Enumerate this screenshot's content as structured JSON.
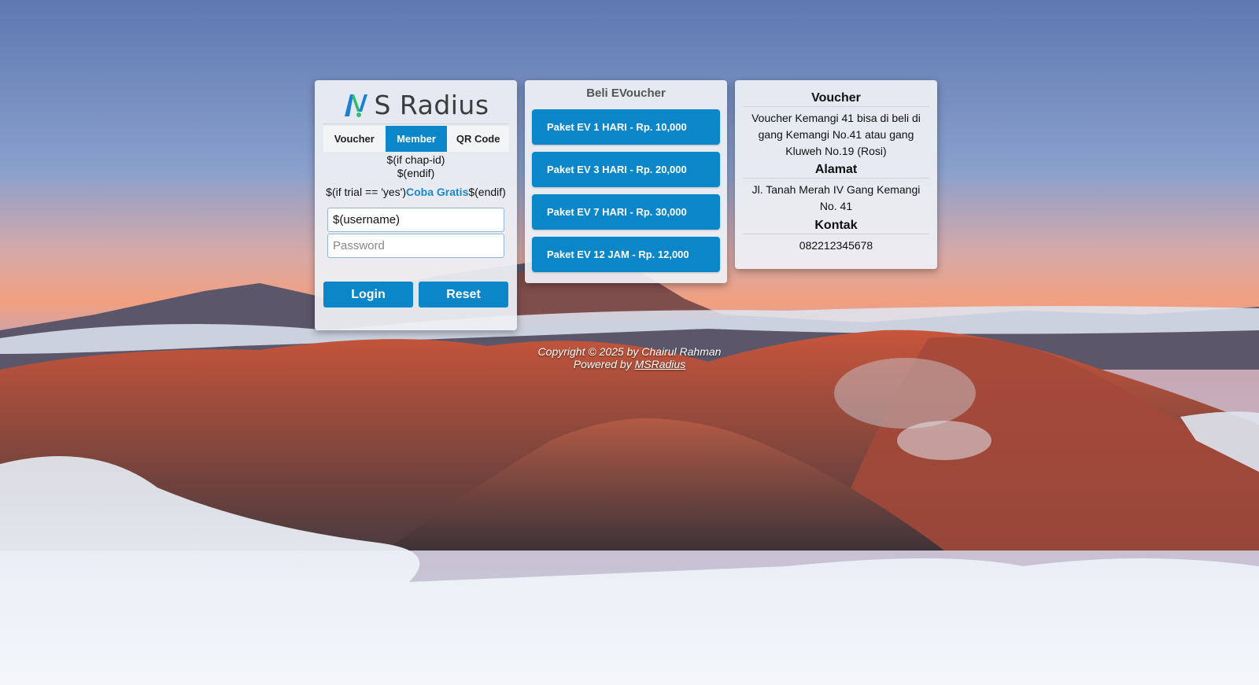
{
  "login": {
    "logo_text": "S Radius",
    "tabs": [
      {
        "label": "Voucher",
        "active": false
      },
      {
        "label": "Member",
        "active": true
      },
      {
        "label": "QR Code",
        "active": false
      }
    ],
    "chap_if": "$(if chap-id)",
    "chap_endif": "$(endif)",
    "trial_prefix": "$(if trial == 'yes')",
    "trial_link": "Coba Gratis",
    "trial_suffix": "$(endif)",
    "username_value": "$(username)",
    "password_placeholder": "Password",
    "login_label": "Login",
    "reset_label": "Reset"
  },
  "shop": {
    "title": "Beli EVoucher",
    "packages": [
      {
        "label": "Paket EV 1 HARI - Rp. 10,000"
      },
      {
        "label": "Paket EV 3 HARI - Rp. 20,000"
      },
      {
        "label": "Paket EV 7 HARI - Rp. 30,000"
      },
      {
        "label": "Paket EV 12 JAM - Rp. 12,000"
      }
    ]
  },
  "info": {
    "voucher_heading": "Voucher",
    "voucher_text": "Voucher Kemangi 41 bisa di beli di gang Kemangi No.41 atau gang Kluweh No.19 (Rosi)",
    "address_heading": "Alamat",
    "address_text": "Jl. Tanah Merah IV Gang Kemangi No. 41",
    "contact_heading": "Kontak",
    "contact_text": "082212345678"
  },
  "footer": {
    "copyright": "Copyright © 2025 by Chairul Rahman",
    "powered_prefix": "Powered by ",
    "powered_link": "MSRadius"
  },
  "colors": {
    "accent": "#0b87c9",
    "logo_green": "#2fbf71",
    "logo_blue": "#1a7fd6"
  }
}
